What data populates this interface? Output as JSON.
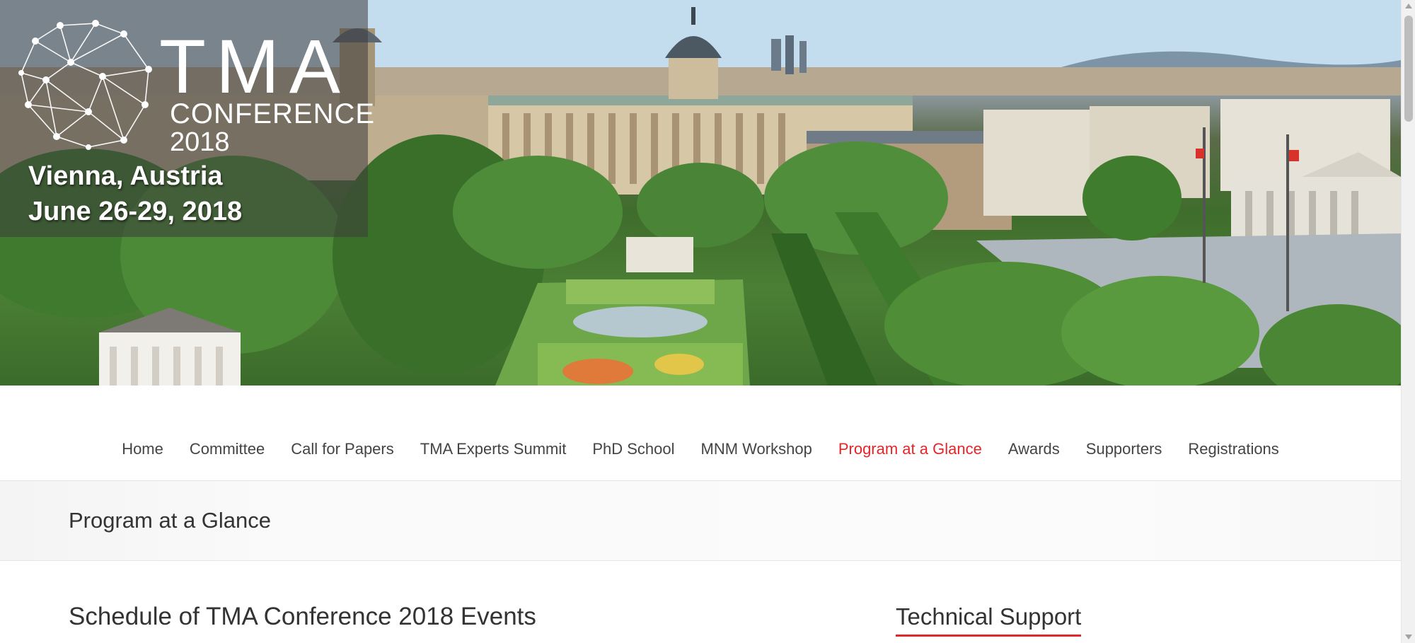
{
  "hero": {
    "logo_tma": "TMA",
    "logo_conference": "CONFERENCE",
    "logo_year": "2018",
    "location": "Vienna, Austria",
    "dates": "June 26-29, 2018"
  },
  "nav": {
    "items": [
      {
        "label": "Home"
      },
      {
        "label": "Committee"
      },
      {
        "label": "Call for Papers"
      },
      {
        "label": "TMA Experts Summit"
      },
      {
        "label": "PhD School"
      },
      {
        "label": "MNM Workshop"
      },
      {
        "label": "Program at a Glance",
        "active": true
      },
      {
        "label": "Awards"
      },
      {
        "label": "Supporters"
      },
      {
        "label": "Registrations"
      }
    ]
  },
  "page": {
    "title": "Program at a Glance"
  },
  "main": {
    "heading": "Schedule of TMA Conference 2018 Events"
  },
  "sidebar": {
    "widget_title": "Technical Support"
  },
  "colors": {
    "accent": "#e4262a",
    "nav_text": "#444444",
    "logo_panel": "#3c3c3c"
  }
}
